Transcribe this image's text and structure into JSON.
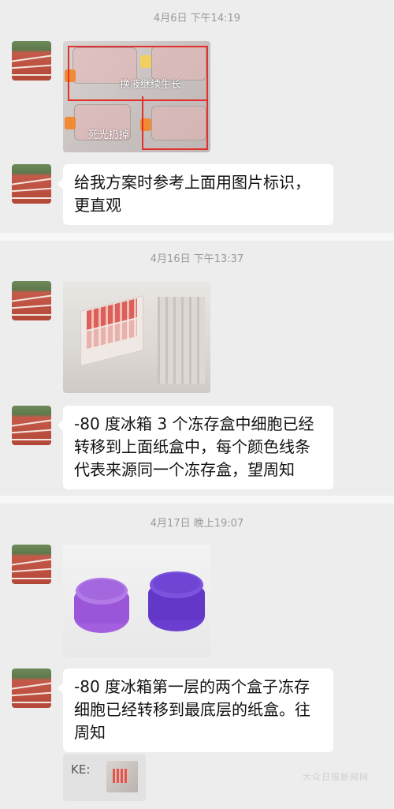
{
  "messages": [
    {
      "timestamp": "4月6日 下午14:19",
      "image": {
        "label_top": "换液继续生长",
        "label_bottom": "死光扔掉",
        "flask_texts": [
          "8-1-",
          "4/6 D 1 7",
          "8-1-",
          "4/6 b 1 7",
          "4/6 b 1 7"
        ]
      },
      "text": "给我方案时参考上面用图片标识，更直观"
    },
    {
      "timestamp": "4月16日 下午13:37",
      "text": "-80 度冰箱 3 个冻存盒中细胞已经转移到上面纸盒中，每个颜色线条代表来源同一个冻存盒，望周知"
    },
    {
      "timestamp": "4月17日 晚上19:07",
      "text": "-80 度冰箱第一层的两个盒子冻存细胞已经转移到最底层的纸盒。往周知"
    }
  ],
  "quote": {
    "label": "KE:"
  },
  "watermark": "大众日报新闻网"
}
